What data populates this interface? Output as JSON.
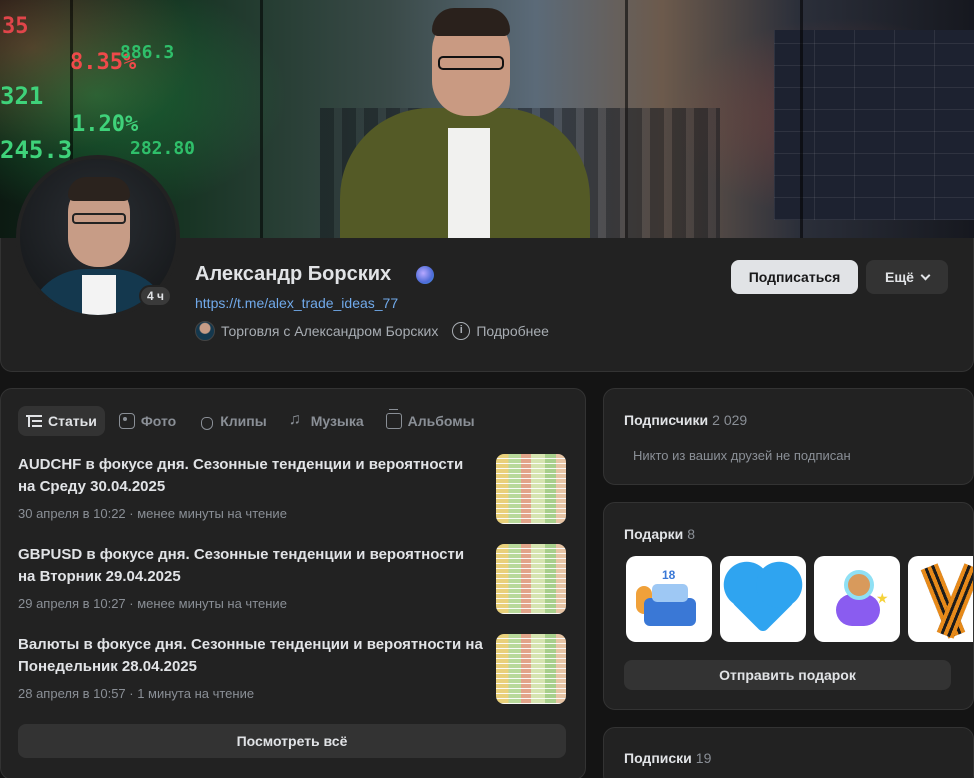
{
  "profile": {
    "name": "Александр Борских",
    "link": "https://t.me/alex_trade_ideas_77",
    "online_badge": "4 ч",
    "group_name": "Торговля с Александром Борских",
    "details_label": "Подробнее",
    "subscribe_label": "Подписаться",
    "more_label": "Ещё"
  },
  "cover": {
    "tickers": [
      "35",
      "8.35%",
      "321",
      "245.3",
      "886.3",
      "1.20%",
      "282.80"
    ]
  },
  "tabs": [
    {
      "label": "Статьи",
      "icon": "articles-icon",
      "active": true
    },
    {
      "label": "Фото",
      "icon": "photo-icon",
      "active": false
    },
    {
      "label": "Клипы",
      "icon": "clips-icon",
      "active": false
    },
    {
      "label": "Музыка",
      "icon": "music-icon",
      "active": false
    },
    {
      "label": "Альбомы",
      "icon": "albums-icon",
      "active": false
    }
  ],
  "articles": [
    {
      "title": "AUDCHF в фокусе дня. Сезонные тенденции и вероятности на Среду 30.04.2025",
      "meta": "30 апреля в 10:22 · менее минуты на чтение"
    },
    {
      "title": "GBPUSD в фокусе дня. Сезонные тенденции и вероятности на Вторник 29.04.2025",
      "meta": "29 апреля в 10:27 · менее минуты на чтение"
    },
    {
      "title": "Валюты в фокусе дня. Сезонные тенденции и вероятности на Понедельник 28.04.2025",
      "meta": "28 апреля в 10:57 · 1 минута на чтение"
    }
  ],
  "view_all_label": "Посмотреть всё",
  "followers": {
    "title": "Подписчики",
    "count": "2 029",
    "note": "Никто из ваших друзей не подписан"
  },
  "gifts": {
    "title": "Подарки",
    "count": "8",
    "items": [
      {
        "icon": "birthday-cake-gift-icon",
        "label": "18"
      },
      {
        "icon": "blue-heart-gift-icon"
      },
      {
        "icon": "astronaut-dog-gift-icon"
      },
      {
        "icon": "st-george-ribbon-gift-icon"
      }
    ],
    "send_label": "Отправить подарок"
  },
  "subscriptions": {
    "title": "Подписки",
    "count": "19"
  },
  "colors": {
    "background": "#141414",
    "panel": "#222222",
    "link": "#71aaeb",
    "button_primary": "#e1e3e6",
    "button_secondary": "#333333"
  }
}
